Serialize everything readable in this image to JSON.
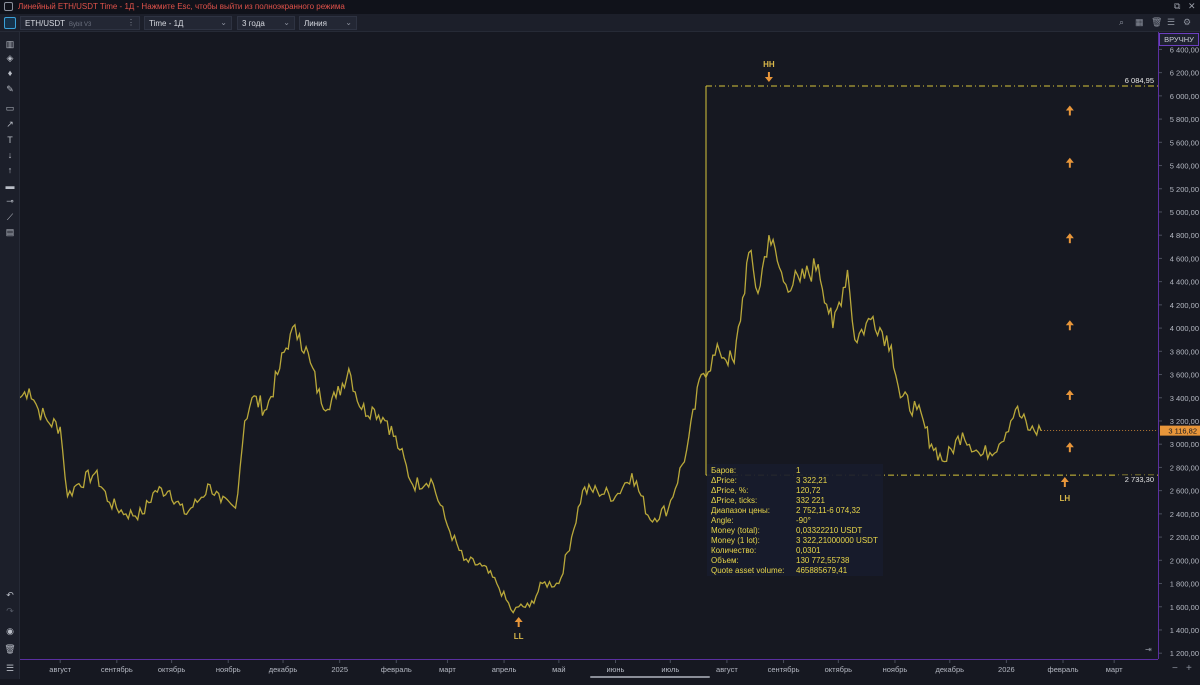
{
  "window": {
    "title": "Линейный ETH/USDT Time - 1Д - Нажмите Esc, чтобы выйти из полноэкранного режима"
  },
  "toolbar": {
    "symbol": "ETH/USDT",
    "exchange": "Bybit V3",
    "timeframe": "Time - 1Д",
    "range": "3 года",
    "chart_style": "Линия"
  },
  "price_axis": {
    "manual_label": "ВРУЧНУ",
    "ticks": [
      "6 400,00",
      "6 200,00",
      "6 000,00",
      "5 800,00",
      "5 600,00",
      "5 400,00",
      "5 200,00",
      "5 000,00",
      "4 800,00",
      "4 600,00",
      "4 400,00",
      "4 200,00",
      "4 000,00",
      "3 800,00",
      "3 600,00",
      "3 400,00",
      "3 200,00",
      "3 000,00",
      "2 800,00",
      "2 600,00",
      "2 400,00",
      "2 200,00",
      "2 000,00",
      "1 800,00",
      "1 600,00",
      "1 400,00",
      "1 200,00"
    ],
    "current_price_label": "3 116,82",
    "level_top_label": "6 084,95",
    "level_bottom_label": "2 733,30"
  },
  "time_axis": {
    "labels": [
      "август",
      "сентябрь",
      "октябрь",
      "ноябрь",
      "декабрь",
      "2025",
      "февраль",
      "март",
      "апрель",
      "май",
      "июнь",
      "июль",
      "август",
      "сентябрь",
      "октябрь",
      "ноябрь",
      "декабрь",
      "2026",
      "февраль",
      "март"
    ]
  },
  "annotations": {
    "hh": "HH",
    "ll": "LL",
    "lh": "LH"
  },
  "stats": {
    "rows": [
      {
        "label": "Баров:",
        "value": "1"
      },
      {
        "label": "ΔPrice:",
        "value": "3 322,21"
      },
      {
        "label": "ΔPrice, %:",
        "value": "120,72"
      },
      {
        "label": "ΔPrice, ticks:",
        "value": "332 221"
      },
      {
        "label": "Диапазон цены:",
        "value": "2 752,11-6 074,32"
      },
      {
        "label": "Angle:",
        "value": "-90°"
      },
      {
        "label": "Money (total):",
        "value": "0,03322210 USDT"
      },
      {
        "label": "Money (1 lot):",
        "value": "3 322,21000000 USDT"
      },
      {
        "label": "Количество:",
        "value": "0,0301"
      },
      {
        "label": "Объем:",
        "value": "130 772,55738"
      },
      {
        "label": "Quote asset volume:",
        "value": "465885679,41"
      }
    ]
  },
  "colors": {
    "line": "#b9a83a",
    "arrow": "#e8963a",
    "level": "#d6c43a",
    "accent": "#6b3fbf"
  },
  "chart_data": {
    "type": "line",
    "title": "",
    "xlabel": "",
    "ylabel": "",
    "ylim": [
      1150,
      6550
    ],
    "x_range": [
      "2024-07-10",
      "2026-03-25"
    ],
    "series": [
      {
        "x": [
          "2024-07-10",
          "2024-07-15",
          "2024-07-20",
          "2024-07-25",
          "2024-08-01",
          "2024-08-05",
          "2024-08-10",
          "2024-08-20",
          "2024-08-28",
          "2024-09-06",
          "2024-09-15",
          "2024-09-22",
          "2024-09-30",
          "2024-10-08",
          "2024-10-15",
          "2024-10-22",
          "2024-10-28",
          "2024-11-05",
          "2024-11-10",
          "2024-11-14",
          "2024-11-22",
          "2024-11-28",
          "2024-12-05",
          "2024-12-10",
          "2024-12-16",
          "2024-12-22",
          "2024-12-30",
          "2025-01-06",
          "2025-01-13",
          "2025-01-20",
          "2025-01-27",
          "2025-02-03",
          "2025-02-10",
          "2025-02-20",
          "2025-03-01",
          "2025-03-10",
          "2025-03-20",
          "2025-03-28",
          "2025-04-06",
          "2025-04-09",
          "2025-04-15",
          "2025-04-22",
          "2025-05-01",
          "2025-05-08",
          "2025-05-14",
          "2025-05-22",
          "2025-06-01",
          "2025-06-10",
          "2025-06-20",
          "2025-06-30",
          "2025-07-10",
          "2025-07-18",
          "2025-07-28",
          "2025-08-05",
          "2025-08-13",
          "2025-08-18",
          "2025-08-24",
          "2025-09-01",
          "2025-09-10",
          "2025-09-20",
          "2025-09-28",
          "2025-10-06",
          "2025-10-10",
          "2025-10-20",
          "2025-10-30",
          "2025-11-04",
          "2025-11-13",
          "2025-11-21",
          "2025-11-28",
          "2025-12-08",
          "2025-12-18",
          "2025-12-28",
          "2026-01-06",
          "2026-01-14",
          "2026-01-20"
        ],
        "values": [
          3400,
          3480,
          3300,
          3200,
          3150,
          2550,
          2650,
          2750,
          2500,
          2400,
          2400,
          2600,
          2600,
          2400,
          2500,
          2650,
          2500,
          2450,
          3200,
          3400,
          3300,
          3600,
          3950,
          3950,
          3700,
          3350,
          3400,
          3650,
          3300,
          3300,
          3200,
          2950,
          2650,
          2700,
          2300,
          2000,
          1950,
          1800,
          1550,
          1600,
          1600,
          1800,
          1800,
          2200,
          2600,
          2600,
          2550,
          2750,
          2350,
          2450,
          2950,
          3600,
          3800,
          3700,
          4650,
          4300,
          4800,
          4400,
          4400,
          4550,
          4000,
          4500,
          3900,
          4100,
          3850,
          3400,
          3300,
          3000,
          2850,
          3100,
          2900,
          3000,
          3300,
          3120,
          3116
        ]
      }
    ],
    "levels": [
      6084.95,
      2733.3
    ],
    "current_price": 3116.82
  }
}
